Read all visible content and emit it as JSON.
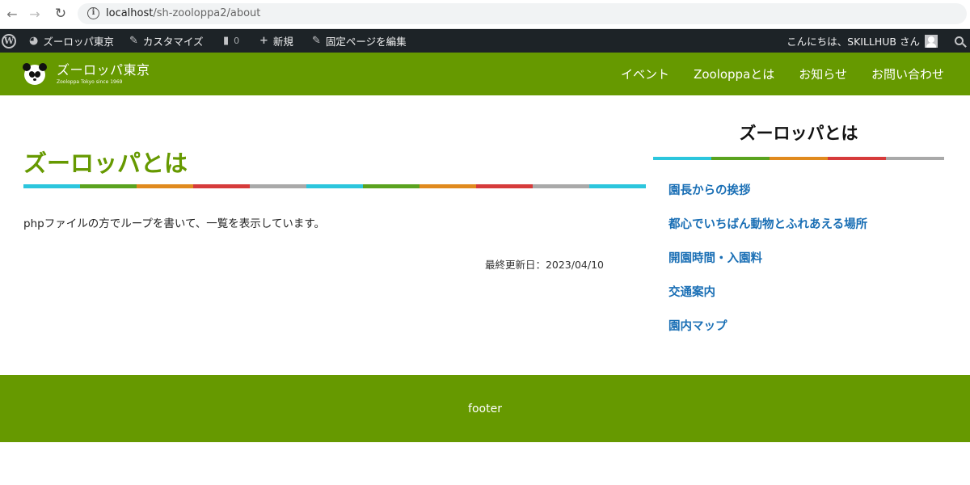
{
  "browser": {
    "url_host": "localhost",
    "url_path": "/sh-zooloppa2/about"
  },
  "admin_bar": {
    "site_name": "ズーロッパ東京",
    "customize": "カスタマイズ",
    "comments": "0",
    "new": "新規",
    "edit_page": "固定ページを編集",
    "greeting": "こんにちは、SKILLHUB さん"
  },
  "header": {
    "site_title": "ズーロッパ東京",
    "tagline": "Zooloppa Tokyo since 1969",
    "nav": [
      {
        "label": "イベント"
      },
      {
        "label": "Zooloppaとは"
      },
      {
        "label": "お知らせ"
      },
      {
        "label": "お問い合わせ"
      }
    ]
  },
  "main": {
    "title": "ズーロッパとは",
    "body": "phpファイルの方でループを書いて、一覧を表示しています。",
    "updated": "最終更新日：2023/04/10"
  },
  "sidebar": {
    "title": "ズーロッパとは",
    "links": [
      {
        "label": "園長からの挨拶"
      },
      {
        "label": "都心でいちばん動物とふれあえる場所"
      },
      {
        "label": "開園時間・入園料"
      },
      {
        "label": "交通案内"
      },
      {
        "label": "園内マップ"
      }
    ]
  },
  "footer": {
    "text": "footer"
  },
  "colors": {
    "brand_green": "#669900",
    "link_blue": "#1a6fb5",
    "admin_bar": "#1d2327",
    "stripe": [
      "#2cc6dd",
      "#5aa31f",
      "#e08a1e",
      "#d63b3b",
      "#a9a9a9"
    ]
  }
}
